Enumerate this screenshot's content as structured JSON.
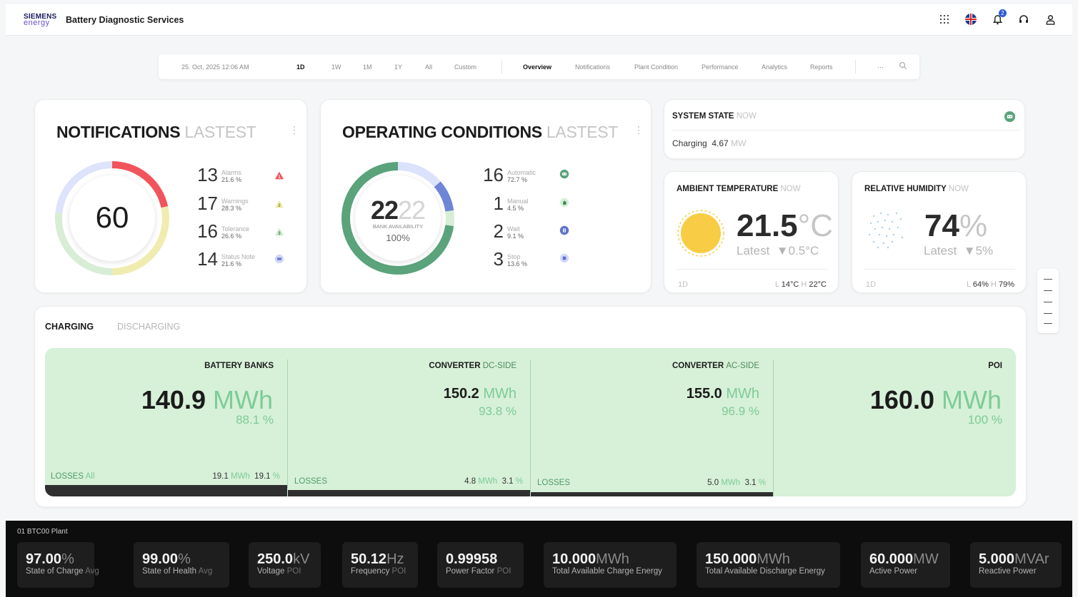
{
  "app": {
    "brand_line1": "SIEMENS",
    "brand_line2": "energy",
    "title": "Battery Diagnostic Services"
  },
  "header": {
    "notification_count": "2",
    "icons": [
      "apps-grid-icon",
      "uk-flag-icon",
      "bell-icon",
      "headset-icon",
      "user-icon"
    ]
  },
  "toolbar": {
    "datetime": "25. Oct, 2025   12:06 AM",
    "ranges": [
      "1D",
      "1W",
      "1M",
      "1Y",
      "All",
      "Custom"
    ],
    "active_range": "1D",
    "tabs": [
      "Overview",
      "Notifications",
      "Plant Condition",
      "Performance",
      "Analytics",
      "Reports"
    ],
    "active_tab": "Overview",
    "more": "···"
  },
  "notifications": {
    "title": "NOTIFICATIONS",
    "subtitle": "LASTEST",
    "total": "60",
    "items": [
      {
        "count": "13",
        "label": "Alarms",
        "pct": "21.6 %",
        "color": "#f2545b"
      },
      {
        "count": "17",
        "label": "Warnings",
        "pct": "28.3 %",
        "color": "#f0e6a2"
      },
      {
        "count": "16",
        "label": "Tolerance",
        "pct": "26.6 %",
        "color": "#bfe3c2"
      },
      {
        "count": "14",
        "label": "Status Note",
        "pct": "21.6 %",
        "color": "#c8d0f5"
      }
    ]
  },
  "operating": {
    "title": "OPERATING CONDITIONS",
    "subtitle": "LASTEST",
    "available": "22",
    "total": "22",
    "caption": "BANK AVAILABILITY",
    "pct": "100%",
    "items": [
      {
        "count": "16",
        "label": "Automatic",
        "pct": "72.7 %"
      },
      {
        "count": "1",
        "label": "Manual",
        "pct": "4.5 %"
      },
      {
        "count": "2",
        "label": "Wait",
        "pct": "9.1 %"
      },
      {
        "count": "3",
        "label": "Stop",
        "pct": "13.6 %"
      }
    ]
  },
  "system_state": {
    "title": "SYSTEM STATE",
    "subtitle": "NOW",
    "state": "Charging",
    "value": "4.67",
    "unit": "MW"
  },
  "ambient": {
    "title": "AMBIENT TEMPERATURE",
    "subtitle": "NOW",
    "value": "21.5",
    "unit": "°C",
    "latest_label": "Latest",
    "delta": "▼0.5°C",
    "range": "1D",
    "low_label": "L",
    "low": "14°C",
    "high_label": "H",
    "high": "22°C"
  },
  "humidity": {
    "title": "RELATIVE HUMIDITY",
    "subtitle": "NOW",
    "value": "74",
    "unit": "%",
    "latest_label": "Latest",
    "delta": "▼5%",
    "range": "1D",
    "low_label": "L",
    "low": "64%",
    "high_label": "H",
    "high": "79%"
  },
  "flow": {
    "tabs": [
      "CHARGING",
      "DISCHARGING"
    ],
    "segments": [
      {
        "title": "BATTERY BANKS",
        "title_muted": "",
        "value": "140.9",
        "unit": "MWh",
        "pct": "88.1 %",
        "loss_label": "LOSSES",
        "loss_sub": "All",
        "loss_value": "19.1",
        "loss_unit": "MWh",
        "loss_pct": "19.1",
        "loss_pct_unit": "%"
      },
      {
        "title": "CONVERTER",
        "title_muted": "DC-SIDE",
        "value": "150.2",
        "unit": "MWh",
        "pct": "93.8 %",
        "loss_label": "LOSSES",
        "loss_value": "4.8",
        "loss_unit": "MWh",
        "loss_pct": "3.1",
        "loss_pct_unit": "%"
      },
      {
        "title": "CONVERTER",
        "title_muted": "AC-SIDE",
        "value": "155.0",
        "unit": "MWh",
        "pct": "96.9 %",
        "loss_label": "LOSSES",
        "loss_value": "5.0",
        "loss_unit": "MWh",
        "loss_pct": "3.1",
        "loss_pct_unit": "%"
      },
      {
        "title": "POI",
        "title_muted": "",
        "value": "160.0",
        "unit": "MWh",
        "pct": "100 %"
      }
    ]
  },
  "kpis": {
    "plant": "01 BTC00 Plant",
    "items": [
      {
        "value": "97.00",
        "unit": "%",
        "label": "State of Charge",
        "sub": "Avg"
      },
      {
        "value": "99.00",
        "unit": "%",
        "label": "State of Health",
        "sub": "Avg"
      },
      {
        "value": "250.0",
        "unit": "kV",
        "label": "Voltage",
        "sub": "POI"
      },
      {
        "value": "50.12",
        "unit": "Hz",
        "label": "Frequency",
        "sub": "POI"
      },
      {
        "value": "0.99958",
        "unit": "",
        "label": "Power Factor",
        "sub": "POI"
      },
      {
        "value": "10.000",
        "unit": "MWh",
        "label": "Total Available Charge Energy",
        "sub": ""
      },
      {
        "value": "150.000",
        "unit": "MWh",
        "label": "Total Available Discharge Energy",
        "sub": ""
      },
      {
        "value": "60.000",
        "unit": "MW",
        "label": "Active Power",
        "sub": ""
      },
      {
        "value": "5.000",
        "unit": "MVAr",
        "label": "Reactive Power",
        "sub": ""
      }
    ]
  }
}
